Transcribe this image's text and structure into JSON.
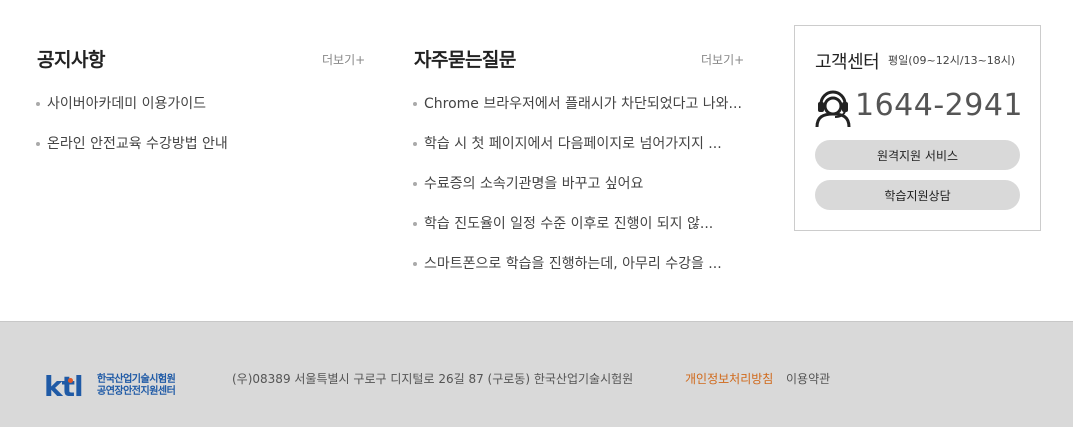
{
  "notice": {
    "title": "공지사항",
    "more": "더보기+",
    "items": [
      "사이버아카데미 이용가이드",
      "온라인 안전교육 수강방법 안내"
    ]
  },
  "faq": {
    "title": "자주묻는질문",
    "more": "더보기+",
    "items": [
      "Chrome 브라우저에서 플래시가 차단되었다고 나와...",
      "학습 시 첫 페이지에서 다음페이지로 넘어가지지 ...",
      "수료증의 소속기관명을 바꾸고 싶어요",
      "학습 진도율이 일정 수준 이후로 진행이 되지 않...",
      "스마트폰으로 학습을 진행하는데, 아무리 수강을 ..."
    ]
  },
  "customer_center": {
    "title": "고객센터",
    "hours": "평일(09~12시/13~18시)",
    "phone": "1644-2941",
    "icon": "headset-icon",
    "remote_support_label": "원격지원 서비스",
    "consult_label": "학습지원상담"
  },
  "footer": {
    "logo_mark": "ktl",
    "logo_line1": "한국산업기술시험원",
    "logo_line2": "공연장안전지원센터",
    "address": "(우)08389 서울특별시 구로구 디지털로 26길 87 (구로동) 한국산업기술시험원",
    "privacy_label": "개인정보처리방침",
    "terms_label": "이용약관",
    "colors": {
      "background": "#d9d9d9",
      "privacy": "#d0691b",
      "logo": "#1f5aa6"
    }
  }
}
